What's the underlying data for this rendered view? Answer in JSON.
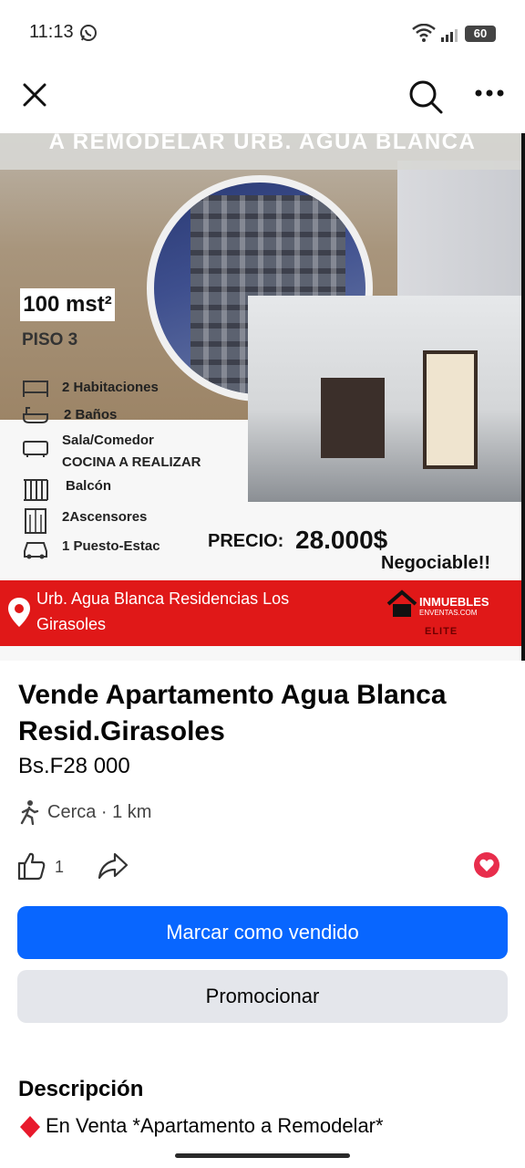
{
  "status_bar": {
    "time": "11:13",
    "battery": "60"
  },
  "top_bar": {
    "close_icon": "close-icon",
    "search_icon": "search-icon",
    "more_icon": "more-icon"
  },
  "photo": {
    "banner": "A REMODELAR URB. AGUA BLANCA",
    "size": "100 mst²",
    "floor": "PISO 3",
    "features": [
      "2 Habitaciones",
      "2 Baños",
      "Sala/Comedor",
      "COCINA A REALIZAR",
      "Balcón",
      "2Ascensores",
      "1 Puesto-Estac"
    ],
    "price_label": "PRECIO:",
    "price_value": "28.000$",
    "negotiable": "Negociable!!",
    "location": "Urb. Agua Blanca Residencias Los Girasoles",
    "logo_line1": "INMUEBLES",
    "logo_line2": "ENVENTAS.COM",
    "logo_line3": "ELITE"
  },
  "listing": {
    "title": "Vende Apartamento Agua Blanca Resid.Girasoles",
    "price": "Bs.F28 000",
    "distance": "Cerca · 1 km",
    "like_count": "1"
  },
  "buttons": {
    "mark_sold": "Marcar como vendido",
    "promote": "Promocionar"
  },
  "description": {
    "heading": "Descripción",
    "first_line": "En Venta *Apartamento a Remodelar*"
  },
  "colors": {
    "primary_button": "#0866ff",
    "secondary_button": "#e4e6eb",
    "flyer_red": "#e01818",
    "heart": "#e82d4c"
  }
}
